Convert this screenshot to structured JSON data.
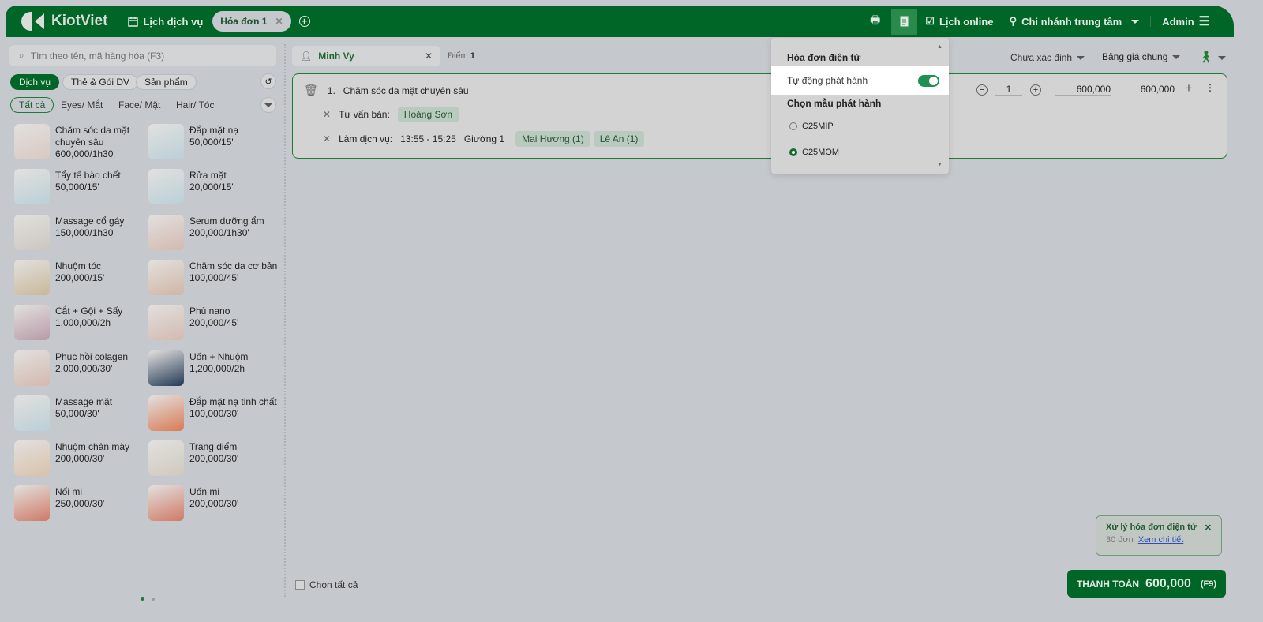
{
  "header": {
    "brand": "KiotViet",
    "schedule": "Lịch dịch vụ",
    "tab": "Hóa đơn 1",
    "online": "Lịch online",
    "branch": "Chi nhánh trung tâm",
    "user": "Admin"
  },
  "search": {
    "placeholder": "Tìm theo tên, mã hàng hóa (F3)"
  },
  "types": [
    "Dịch vụ",
    "Thẻ & Gói DV",
    "Sản phẩm"
  ],
  "categories": [
    "Tất cả",
    "Eyes/ Mắt",
    "Face/ Mặt",
    "Hair/ Tóc"
  ],
  "products": [
    {
      "name": "Chăm sóc da mặt chuyên sâu",
      "price": "600,000/1h30'",
      "color": "#d9c8c2"
    },
    {
      "name": "Đắp mặt nạ",
      "price": "50,000/15'",
      "color": "#b9d0d8"
    },
    {
      "name": "Tẩy tế bào chết",
      "price": "50,000/15'",
      "color": "#b9d0d8"
    },
    {
      "name": "Rửa mặt",
      "price": "20,000/15'",
      "color": "#b9d0d8"
    },
    {
      "name": "Massage cổ gáy",
      "price": "150,000/1h30'",
      "color": "#cbc6bf"
    },
    {
      "name": "Serum dưỡng ẩm",
      "price": "200,000/1h30'",
      "color": "#d3b9b0"
    },
    {
      "name": "Nhuộm tóc",
      "price": "200,000/15'",
      "color": "#c8b89a"
    },
    {
      "name": "Chăm sóc da cơ bản",
      "price": "100,000/45'",
      "color": "#d0b5a5"
    },
    {
      "name": "Cắt + Gội + Sấy",
      "price": "1,000,000/2h",
      "color": "#b99aa8"
    },
    {
      "name": "Phủ nano",
      "price": "200,000/45'",
      "color": "#d3b9b0"
    },
    {
      "name": "Phục hồi colagen",
      "price": "2,000,000/30'",
      "color": "#d3b9b0"
    },
    {
      "name": "Uốn + Nhuộm",
      "price": "1,200,000/2h",
      "color": "#223a55"
    },
    {
      "name": "Massage mặt",
      "price": "50,000/30'",
      "color": "#b9d0d8"
    },
    {
      "name": "Đắp mặt nạ tinh chất",
      "price": "100,000/30'",
      "color": "#d97a55"
    },
    {
      "name": "Nhuộm chân mày",
      "price": "200,000/30'",
      "color": "#d8c2aa"
    },
    {
      "name": "Trang điểm",
      "price": "200,000/30'",
      "color": "#cfc9bf"
    },
    {
      "name": "Nối mi",
      "price": "250,000/30'",
      "color": "#cf7a66"
    },
    {
      "name": "Uốn mi",
      "price": "200,000/30'",
      "color": "#cf7a66"
    }
  ],
  "select_all": "Chọn tất cả",
  "customer": {
    "name": "Minh Vy",
    "points_label": "Điểm",
    "points": "1"
  },
  "filters": {
    "status": "Chưa xác định",
    "pricebook": "Bảng giá chung"
  },
  "line": {
    "index": "1.",
    "name": "Chăm sóc da mặt chuyên sâu",
    "qty": "1",
    "price": "600,000",
    "total": "600,000",
    "consultant_label": "Tư vấn bán:",
    "consultant": "Hoàng Sơn",
    "service_label": "Làm dịch vụ:",
    "time": "13:55 - 15:25",
    "bed": "Giường 1",
    "staff": [
      "Mai Hương (1)",
      "Lê An (1)"
    ]
  },
  "einvoice": {
    "title": "Hóa đơn điện tử",
    "auto_label": "Tự động phát hành",
    "auto_on": true,
    "template_title": "Chọn mẫu phát hành",
    "templates": [
      "C25MIP",
      "C25MOM"
    ],
    "selected": "C25MOM"
  },
  "toast": {
    "title": "Xử lý hóa đơn điện tử",
    "count": "30 đơn",
    "link": "Xem chi tiết"
  },
  "pay": {
    "label": "THANH TOÁN",
    "amount": "600,000",
    "shortcut": "(F9)"
  },
  "colors": {
    "brand": "#006627"
  }
}
